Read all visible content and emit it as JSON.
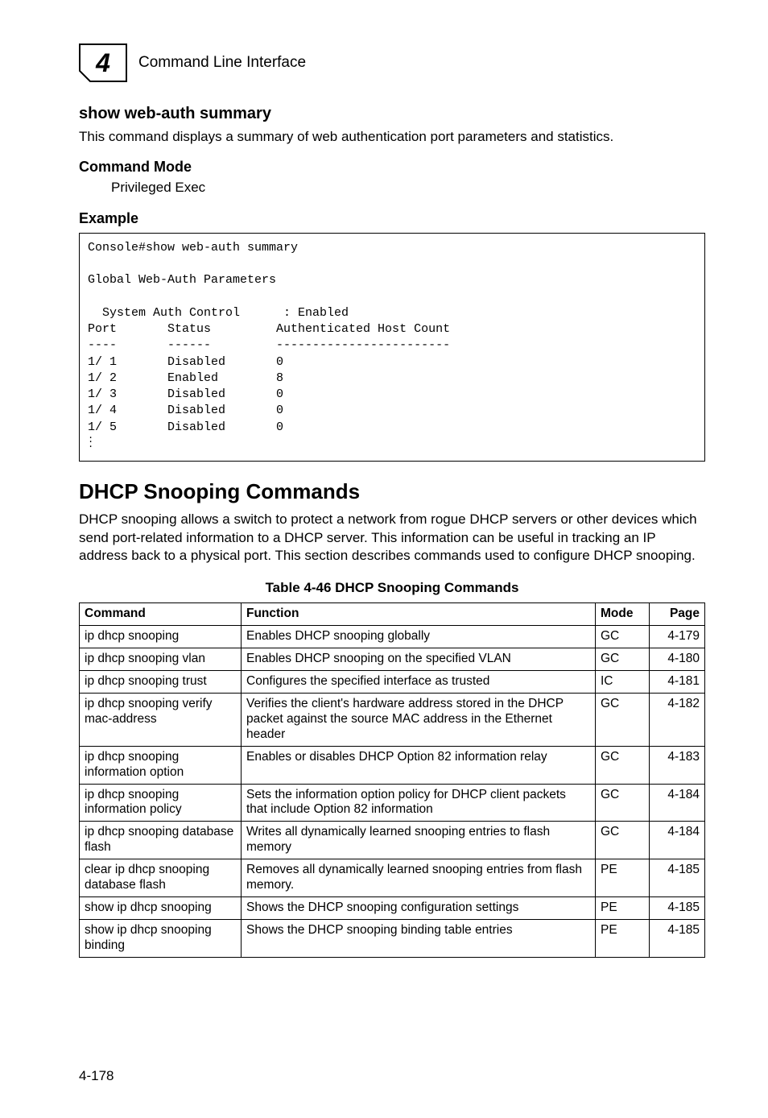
{
  "top": {
    "title": "Command Line Interface",
    "tab_number": "4"
  },
  "cmd": {
    "title": "show web-auth summary",
    "desc": "This command displays a summary of web authentication port parameters and statistics."
  },
  "cmdmode": {
    "heading": "Command Mode",
    "value": "Privileged Exec"
  },
  "example": {
    "heading": "Example"
  },
  "console": {
    "line1": "Console#show web-auth summary",
    "line2": "",
    "line3": "Global Web-Auth Parameters",
    "line4": "",
    "line5": "  System Auth Control      : Enabled",
    "line6": "Port       Status         Authenticated Host Count",
    "line7": "----       ------         ------------------------",
    "line8": "1/ 1       Disabled       0",
    "line9": "1/ 2       Enabled        8",
    "line10": "1/ 3       Disabled       0",
    "line11": "1/ 4       Disabled       0",
    "line12": "1/ 5       Disabled       0"
  },
  "section": {
    "title": "DHCP Snooping Commands",
    "desc": "DHCP snooping allows a switch to protect a network from rogue DHCP servers or other devices which send port-related information to a DHCP server. This information can be useful in tracking an IP address back to a physical port. This section describes commands used to configure DHCP snooping."
  },
  "table": {
    "caption": "Table 4-46  DHCP Snooping Commands",
    "headers": {
      "command": "Command",
      "function": "Function",
      "mode": "Mode",
      "page": "Page"
    },
    "rows": [
      {
        "command": "ip dhcp snooping",
        "function": "Enables DHCP snooping globally",
        "mode": "GC",
        "page": "4-179"
      },
      {
        "command": "ip dhcp snooping vlan",
        "function": "Enables DHCP snooping on the specified VLAN",
        "mode": "GC",
        "page": "4-180"
      },
      {
        "command": "ip dhcp snooping trust",
        "function": "Configures the specified interface as trusted",
        "mode": "IC",
        "page": "4-181"
      },
      {
        "command": "ip dhcp snooping verify mac-address",
        "function": "Verifies the client's hardware address stored in the DHCP packet against the source MAC address in the Ethernet header",
        "mode": "GC",
        "page": "4-182"
      },
      {
        "command": "ip dhcp snooping information option",
        "function": "Enables or disables DHCP Option 82 information relay",
        "mode": "GC",
        "page": "4-183"
      },
      {
        "command": "ip dhcp snooping information policy",
        "function": "Sets the information option policy for DHCP client packets that include Option 82 information",
        "mode": "GC",
        "page": "4-184"
      },
      {
        "command": "ip dhcp snooping database flash",
        "function": "Writes all dynamically learned snooping entries to flash memory",
        "mode": "GC",
        "page": "4-184"
      },
      {
        "command": "clear ip dhcp snooping database flash",
        "function": "Removes all dynamically learned snooping entries from flash memory.",
        "mode": "PE",
        "page": "4-185"
      },
      {
        "command": "show ip dhcp snooping",
        "function": "Shows the DHCP snooping configuration settings",
        "mode": "PE",
        "page": "4-185"
      },
      {
        "command": "show ip dhcp snooping binding",
        "function": "Shows the DHCP snooping binding table entries",
        "mode": "PE",
        "page": "4-185"
      }
    ]
  },
  "footer": {
    "page": "4-178"
  }
}
